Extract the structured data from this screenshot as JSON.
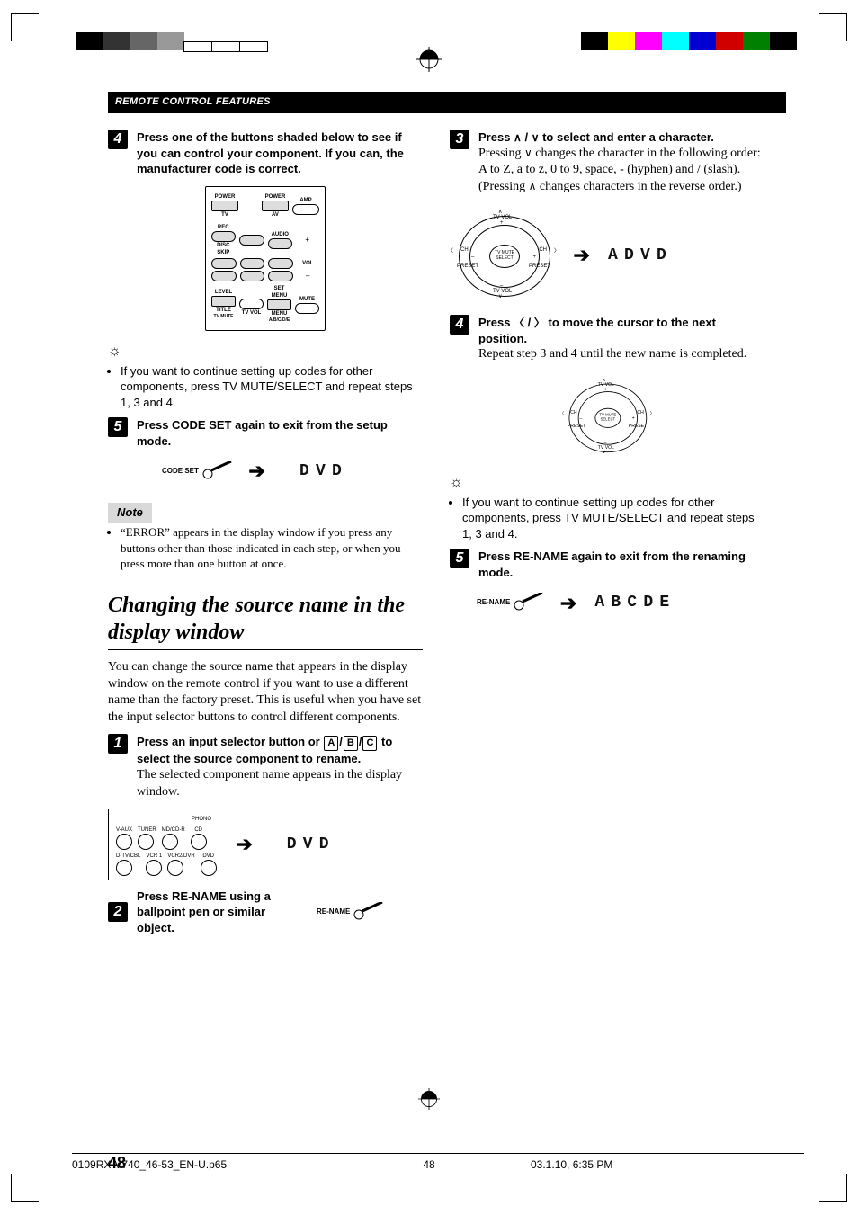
{
  "header": "REMOTE CONTROL FEATURES",
  "left": {
    "step4": {
      "num": "4",
      "title": "Press one of the buttons shaded below to see if you can control your component. If you can, the manufacturer code is correct."
    },
    "remote": {
      "power1": "POWER",
      "tv": "TV",
      "power2": "POWER",
      "av": "AV",
      "amp": "AMP",
      "rec": "REC",
      "discskip": "DISC SKIP",
      "audio": "AUDIO",
      "vol": "VOL",
      "level": "LEVEL",
      "title": "TITLE",
      "tvmute": "TV MUTE",
      "tvvol": "TV VOL",
      "setmenu": "SET MENU",
      "menu": "MENU",
      "abcde": "A/B/C/D/E",
      "mute": "MUTE"
    },
    "tip_bullet": "If you want to continue setting up codes for other components, press TV MUTE/SELECT and repeat steps 1, 3 and 4.",
    "step5": {
      "num": "5",
      "title": "Press CODE SET again to exit from the setup mode."
    },
    "codeset_label": "CODE SET",
    "display5": {
      "seg": [
        "",
        "D",
        "V",
        "D",
        ""
      ]
    },
    "note_label": "Note",
    "note_bullet": "“ERROR” appears in the display window if you press any buttons other than those indicated in each step, or when you press more than one button at once.",
    "section_title": "Changing the source name in the display window",
    "section_para": "You can change the source name that appears in the display window on the remote control if you want to use a different name than the factory preset. This is useful when you have set the input selector buttons to control different components.",
    "r_step1": {
      "num": "1",
      "title_a": "Press an input selector button or ",
      "key_a": "A",
      "key_b": "B",
      "key_c": "C",
      "title_b": " to select the source component to rename.",
      "text": "The selected component name appears in the display window."
    },
    "selector_labels": [
      "V-AUX",
      "TUNER",
      "MD/CD-R",
      "CD",
      "PHONO",
      "D-TV/CBL",
      "VCR 1",
      "VCR2/DVR",
      "DVD"
    ],
    "display1": {
      "seg": [
        "",
        "D",
        "V",
        "D",
        ""
      ]
    },
    "r_step2": {
      "num": "2",
      "title": "Press RE-NAME using a ballpoint pen or similar object."
    },
    "rename_label": "RE-NAME"
  },
  "right": {
    "step3": {
      "num": "3",
      "title_a": "Press ",
      "title_b": " / ",
      "title_c": " to select and enter a character.",
      "text_a": "Pressing ",
      "text_b": " changes the character in the following order: A to Z, a to z, 0 to 9, space, - (hyphen) and / (slash). (Pressing ",
      "text_c": " changes characters in the reverse order.)"
    },
    "dpad": {
      "ch": "CH",
      "plus": "+",
      "minus": "–",
      "preset": "PRESET",
      "tvvol": "TV VOL",
      "center": "TV MUTE\nSELECT"
    },
    "display3": {
      "seg": [
        "A",
        "D",
        "V",
        "D",
        ""
      ]
    },
    "step4": {
      "num": "4",
      "title_a": "Press ",
      "title_b": " / ",
      "title_c": " to move the cursor to the next position.",
      "text": "Repeat step 3 and 4 until the new name is completed."
    },
    "tip_bullet": "If you want to continue setting up codes for other components, press TV MUTE/SELECT and repeat steps 1, 3 and 4.",
    "step5": {
      "num": "5",
      "title": "Press RE-NAME again to exit from the renaming mode."
    },
    "display5": {
      "seg": [
        "A",
        "B",
        "C",
        "D",
        "E"
      ]
    },
    "rename_label": "RE-NAME"
  },
  "pagefoot": {
    "num": "48",
    "file": "0109RX-V740_46-53_EN-U.p65",
    "pnum": "48",
    "stamp": "03.1.10, 6:35 PM"
  }
}
